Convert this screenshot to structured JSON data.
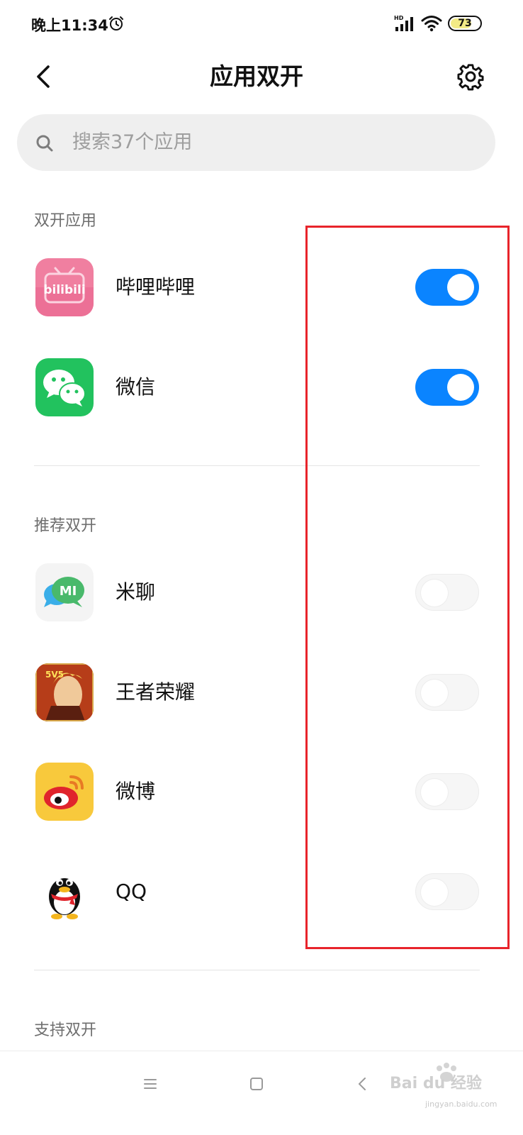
{
  "status_bar": {
    "time": "晚上11:34",
    "signal_label": "HD",
    "battery_level": "73"
  },
  "header": {
    "title": "应用双开"
  },
  "search": {
    "placeholder": "搜索37个应用"
  },
  "sections": [
    {
      "title": "双开应用"
    },
    {
      "title": "推荐双开"
    },
    {
      "title": "支持双开"
    }
  ],
  "apps": [
    {
      "name": "哔哩哔哩",
      "icon": "bilibili-icon",
      "icon_text": "bilibili",
      "enabled": true
    },
    {
      "name": "微信",
      "icon": "wechat-icon",
      "enabled": true
    },
    {
      "name": "米聊",
      "icon": "miliao-icon",
      "icon_text": "MI",
      "enabled": false
    },
    {
      "name": "王者荣耀",
      "icon": "honor-of-kings-icon",
      "icon_text": "5V5",
      "enabled": false
    },
    {
      "name": "微博",
      "icon": "weibo-icon",
      "enabled": false
    },
    {
      "name": "QQ",
      "icon": "qq-icon",
      "enabled": false
    }
  ],
  "watermark": {
    "brand": "Bai du 经验",
    "url": "jingyan.baidu.com"
  },
  "colors": {
    "accent": "#0a84ff",
    "highlight": "#e8242b"
  }
}
